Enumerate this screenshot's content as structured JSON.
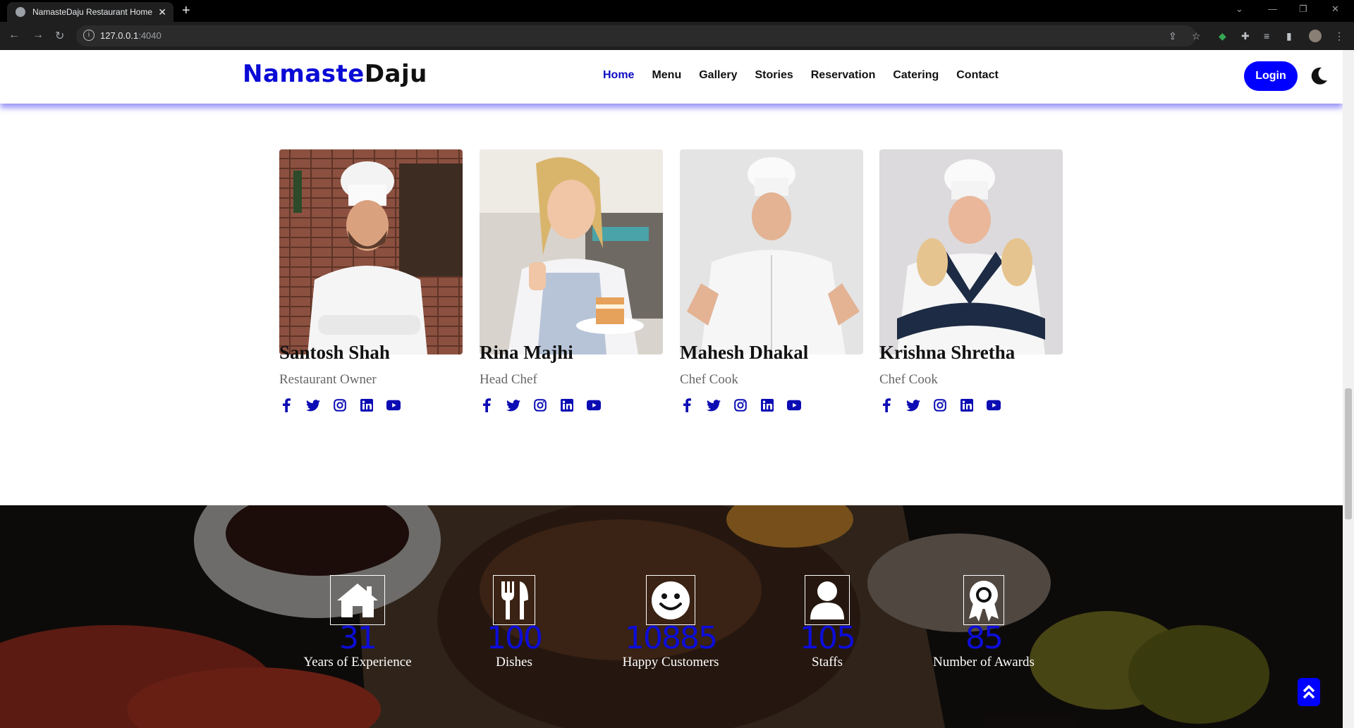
{
  "browser": {
    "tab_title": "NamasteDaju Restaurant Home",
    "url_host": "127.0.0.1",
    "url_port": ":4040"
  },
  "site": {
    "logo_part1": "Namaste",
    "logo_part2": "Daju",
    "nav": [
      {
        "label": "Home"
      },
      {
        "label": "Menu"
      },
      {
        "label": "Gallery"
      },
      {
        "label": "Stories"
      },
      {
        "label": "Reservation"
      },
      {
        "label": "Catering"
      },
      {
        "label": "Contact"
      }
    ],
    "login_label": "Login",
    "accent_color": "#0000ff"
  },
  "team": [
    {
      "name": "Santosh Shah",
      "role": "Restaurant Owner"
    },
    {
      "name": "Rina Majhi",
      "role": "Head Chef"
    },
    {
      "name": "Mahesh Dhakal",
      "role": "Chef Cook"
    },
    {
      "name": "Krishna Shretha",
      "role": "Chef Cook"
    }
  ],
  "social_icons": [
    "facebook-icon",
    "twitter-icon",
    "instagram-icon",
    "linkedin-icon",
    "youtube-icon"
  ],
  "stats": [
    {
      "icon": "home-icon",
      "value": "31",
      "label": "Years of Experience"
    },
    {
      "icon": "utensils-icon",
      "value": "100",
      "label": "Dishes"
    },
    {
      "icon": "smile-icon",
      "value": "10885",
      "label": "Happy Customers"
    },
    {
      "icon": "user-icon",
      "value": "105",
      "label": "Staffs"
    },
    {
      "icon": "award-icon",
      "value": "85",
      "label": "Number of Awards"
    }
  ]
}
